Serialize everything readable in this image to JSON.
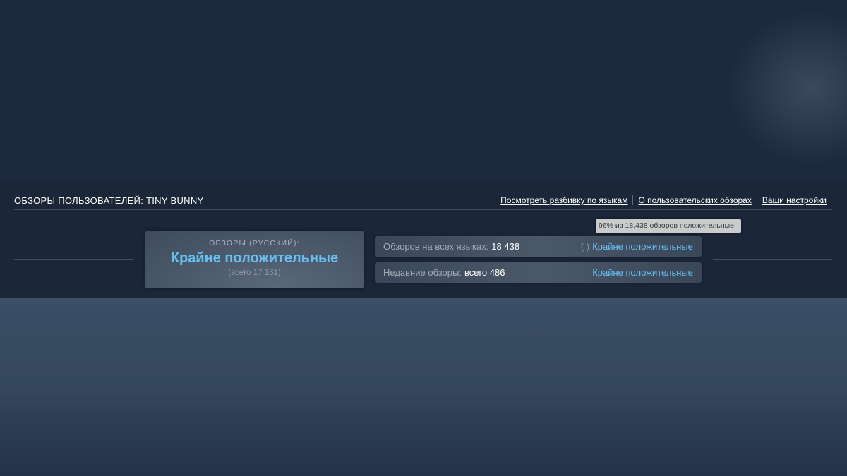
{
  "section_title": "ОБЗОРЫ ПОЛЬЗОВАТЕЛЕЙ: TINY BUNNY",
  "links": [
    "Посмотреть разбивку по языкам",
    "О пользовательских обзорах",
    "Ваши настройки"
  ],
  "summary": {
    "label": "ОБЗОРЫ (РУССКИЙ):",
    "rating": "Крайне положительные",
    "total": "(всего 17 131)"
  },
  "all_languages": {
    "label": "Обзоров на всех языках:",
    "value": "18 438",
    "parens": "( )",
    "rating": "Крайне положительные"
  },
  "recent": {
    "label": "Недавние обзоры:",
    "value": "всего 486",
    "rating": "Крайне положительные"
  },
  "tooltip": "96% из 18,438 обзоров положительные.",
  "colors": {
    "accent": "#66c0f4",
    "background": "#1b2638"
  }
}
